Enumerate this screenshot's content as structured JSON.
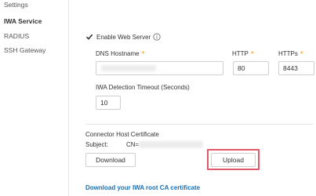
{
  "sidebar": {
    "items": [
      {
        "label": "Settings"
      },
      {
        "label": "IWA Service"
      },
      {
        "label": "RADIUS"
      },
      {
        "label": "SSH Gateway"
      }
    ]
  },
  "form": {
    "enable_web_server_label": "Enable Web Server",
    "enable_web_server_checked": true,
    "dns_hostname_label": "DNS Hostname",
    "dns_hostname_value": "",
    "http_label": "HTTP",
    "http_value": "80",
    "https_label": "HTTPs",
    "https_value": "8443",
    "iwa_timeout_label": "IWA Detection Timeout (Seconds)",
    "iwa_timeout_value": "10",
    "required_mark": "*"
  },
  "certificate": {
    "title": "Connector Host Certificate",
    "subject_label": "Subject:",
    "cn_prefix": "CN=",
    "download_label": "Download",
    "upload_label": "Upload",
    "root_ca_link": "Download your IWA root CA certificate"
  },
  "colors": {
    "required": "#f39c12",
    "link": "#1a6fb0",
    "highlight": "#e05a6a"
  }
}
